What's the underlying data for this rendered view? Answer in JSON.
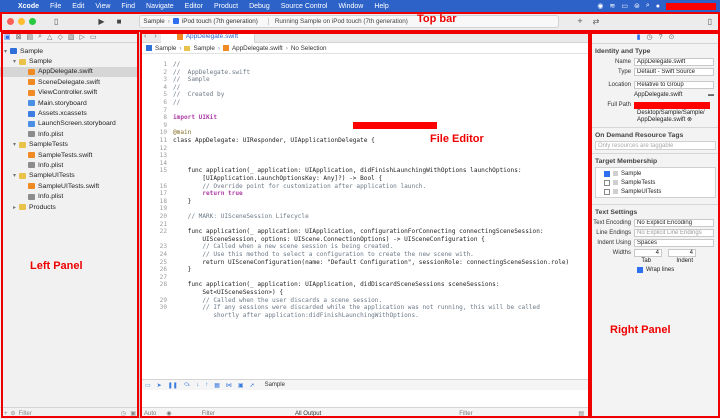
{
  "menubar": {
    "app": "Xcode",
    "items": [
      "File",
      "Edit",
      "View",
      "Find",
      "Navigate",
      "Editor",
      "Product",
      "Debug",
      "Source Control",
      "Window",
      "Help"
    ]
  },
  "toolbar": {
    "scheme": "Sample",
    "destination": "iPod touch (7th generation)",
    "status": "Running Sample on iPod touch (7th generation)"
  },
  "annotations": {
    "top_bar": "Top bar",
    "left_panel": "Left Panel",
    "file_editor": "File Editor",
    "right_panel": "Right Panel"
  },
  "navigator": {
    "items": [
      {
        "label": "Sample",
        "icon": "project-icon",
        "indent": 0,
        "chev": "▾"
      },
      {
        "label": "Sample",
        "icon": "folder-icon",
        "indent": 1,
        "chev": "▾"
      },
      {
        "label": "AppDelegate.swift",
        "icon": "swift-file-icon",
        "indent": 2,
        "selected": true
      },
      {
        "label": "SceneDelegate.swift",
        "icon": "swift-file-icon",
        "indent": 2
      },
      {
        "label": "ViewController.swift",
        "icon": "swift-file-icon",
        "indent": 2
      },
      {
        "label": "Main.storyboard",
        "icon": "storyboard-icon",
        "indent": 2
      },
      {
        "label": "Assets.xcassets",
        "icon": "assets-icon",
        "indent": 2
      },
      {
        "label": "LaunchScreen.storyboard",
        "icon": "storyboard-icon",
        "indent": 2
      },
      {
        "label": "Info.plist",
        "icon": "plist-icon",
        "indent": 2
      },
      {
        "label": "SampleTests",
        "icon": "folder-icon",
        "indent": 1,
        "chev": "▾"
      },
      {
        "label": "SampleTests.swift",
        "icon": "swift-file-icon",
        "indent": 2
      },
      {
        "label": "Info.plist",
        "icon": "plist-icon",
        "indent": 2
      },
      {
        "label": "SampleUITests",
        "icon": "folder-icon",
        "indent": 1,
        "chev": "▾"
      },
      {
        "label": "SampleUITests.swift",
        "icon": "swift-file-icon",
        "indent": 2
      },
      {
        "label": "Info.plist",
        "icon": "plist-icon",
        "indent": 2
      },
      {
        "label": "Products",
        "icon": "folder-icon",
        "indent": 1,
        "chev": "▸"
      }
    ],
    "filter_placeholder": "Filter"
  },
  "editor": {
    "tab": "AppDelegate.swift",
    "jump": [
      "Sample",
      "Sample",
      "AppDelegate.swift",
      "No Selection"
    ],
    "debug_target": "Sample",
    "bottom": {
      "auto": "Auto",
      "filter1": "Filter",
      "output": "All Output",
      "filter2": "Filter"
    },
    "lines": [
      {
        "n": "1",
        "t": "//",
        "c": "cm"
      },
      {
        "n": "2",
        "t": "//  AppDelegate.swift",
        "c": "cm"
      },
      {
        "n": "3",
        "t": "//  Sample",
        "c": "cm"
      },
      {
        "n": "4",
        "t": "//",
        "c": "cm"
      },
      {
        "n": "5",
        "t": "//  Created by",
        "c": "cm"
      },
      {
        "n": "6",
        "t": "//",
        "c": "cm"
      },
      {
        "n": "7",
        "t": "",
        "c": ""
      },
      {
        "n": "8",
        "t": "import UIKit",
        "c": "kw"
      },
      {
        "n": "9",
        "t": "",
        "c": ""
      },
      {
        "n": "10",
        "t": "@main",
        "c": "at"
      },
      {
        "n": "11",
        "t": "class AppDelegate: UIResponder, UIApplicationDelegate {",
        "c": ""
      },
      {
        "n": "12",
        "t": "",
        "c": ""
      },
      {
        "n": "13",
        "t": "",
        "c": ""
      },
      {
        "n": "14",
        "t": "",
        "c": ""
      },
      {
        "n": "15",
        "t": "    func application(_ application: UIApplication, didFinishLaunchingWithOptions launchOptions:",
        "c": ""
      },
      {
        "n": "",
        "t": "        [UIApplication.LaunchOptionsKey: Any]?) -> Bool {",
        "c": ""
      },
      {
        "n": "16",
        "t": "        // Override point for customization after application launch.",
        "c": "cm"
      },
      {
        "n": "17",
        "t": "        return true",
        "c": "kw"
      },
      {
        "n": "18",
        "t": "    }",
        "c": ""
      },
      {
        "n": "19",
        "t": "",
        "c": ""
      },
      {
        "n": "20",
        "t": "    // MARK: UISceneSession Lifecycle",
        "c": "cm"
      },
      {
        "n": "21",
        "t": "",
        "c": ""
      },
      {
        "n": "22",
        "t": "    func application(_ application: UIApplication, configurationForConnecting connectingSceneSession:",
        "c": ""
      },
      {
        "n": "",
        "t": "        UISceneSession, options: UIScene.ConnectionOptions) -> UISceneConfiguration {",
        "c": ""
      },
      {
        "n": "23",
        "t": "        // Called when a new scene session is being created.",
        "c": "cm"
      },
      {
        "n": "24",
        "t": "        // Use this method to select a configuration to create the new scene with.",
        "c": "cm"
      },
      {
        "n": "25",
        "t": "        return UISceneConfiguration(name: \"Default Configuration\", sessionRole: connectingSceneSession.role)",
        "c": ""
      },
      {
        "n": "26",
        "t": "    }",
        "c": ""
      },
      {
        "n": "27",
        "t": "",
        "c": ""
      },
      {
        "n": "28",
        "t": "    func application(_ application: UIApplication, didDiscardSceneSessions sceneSessions:",
        "c": ""
      },
      {
        "n": "",
        "t": "        Set<UISceneSession>) {",
        "c": ""
      },
      {
        "n": "29",
        "t": "        // Called when the user discards a scene session.",
        "c": "cm"
      },
      {
        "n": "30",
        "t": "        // If any sessions were discarded while the application was not running, this will be called",
        "c": "cm"
      },
      {
        "n": "",
        "t": "           shortly after application:didFinishLaunchingWithOptions.",
        "c": "cm"
      }
    ]
  },
  "inspector": {
    "identity_title": "Identity and Type",
    "name_label": "Name",
    "name_value": "AppDelegate.swift",
    "type_label": "Type",
    "type_value": "Default - Swift Source",
    "location_label": "Location",
    "location_value": "Relative to Group",
    "location_file": "AppDelegate.swift",
    "fullpath_label": "Full Path",
    "fullpath_value1": "Desktop/Sample/Sample/",
    "fullpath_value2": "AppDelegate.swift",
    "ondemand_title": "On Demand Resource Tags",
    "ondemand_placeholder": "Only resources are taggable",
    "target_title": "Target Membership",
    "targets": [
      {
        "label": "Sample",
        "checked": true
      },
      {
        "label": "SampleTests",
        "checked": false
      },
      {
        "label": "SampleUITests",
        "checked": false
      }
    ],
    "text_title": "Text Settings",
    "encoding_label": "Text Encoding",
    "encoding_value": "No Explicit Encoding",
    "endings_label": "Line Endings",
    "endings_value": "No Explicit Line Endings",
    "indent_label": "Indent Using",
    "indent_value": "Spaces",
    "widths_label": "Widths",
    "tab_value": "4",
    "indent_width_value": "4",
    "tab_caption": "Tab",
    "indent_caption": "Indent",
    "wrap_label": "Wrap lines"
  }
}
